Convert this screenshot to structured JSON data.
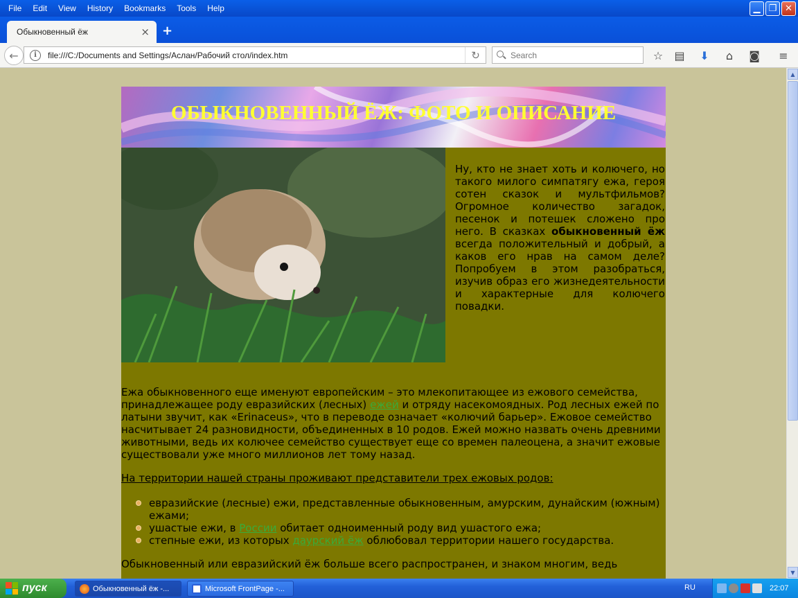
{
  "menu": [
    "File",
    "Edit",
    "View",
    "History",
    "Bookmarks",
    "Tools",
    "Help"
  ],
  "tab": {
    "title": "Обыкновенный ёж",
    "close": "×",
    "new": "+"
  },
  "nav": {
    "url": "file:///C:/Documents and Settings/Аслан/Рабочий стол/index.htm",
    "search_placeholder": "Search"
  },
  "page": {
    "title": "ОБЫКНОВЕННЫЙ ЁЖ: ФОТО И ОПИСАНИЕ",
    "intro_pre": "Ну, кто не знает хоть и колючего, но такого милого симпатягу ежа, героя сотен сказок и мультфильмов? Огромное количество загадок, песенок и потешек сложено про него. В сказках ",
    "intro_bold": "обыкновенный ёж",
    "intro_post": " всегда положительный и добрый, а каков его нрав на самом деле? Попробуем в этом разобраться, изучив образ его жизнедеятельности и характерные для колючего повадки.",
    "p1_a": "Ежа обыкновенного еще именуют европейским – это млекопитающее из ежового семейства, принадлежащее роду евразийских (лесных) ",
    "p1_link": "ежей",
    "p1_b": " и отряду насекомоядных. Род лесных ежей по латыни звучит, как «Erinaceus», что в переводе означает «колючий барьер». Ежовое семейство насчитывает 24 разновидности, объединенных в 10 родов. Ежей можно назвать очень древними животными, ведь их колючее семейство существует еще со времен палеоцена, а значит ежовые существовали уже много миллионов лет тому назад.",
    "subhead": "На территории нашей страны проживают представители трех ежовых родов:",
    "li1": "евразийские (лесные) ежи, представленные обыкновенным, амурским, дунайским (южным) ежами;",
    "li2_a": "ушастые ежи, в ",
    "li2_link": "России",
    "li2_b": " обитает одноименный роду вид ушастого ежа;",
    "li3_a": "степные ежи, из которых ",
    "li3_link": "даурский ёж",
    "li3_b": " облюбовал территории нашего государства.",
    "p2": "Обыкновенный или евразийский ёж больше всего распространен, и знаком многим, ведь"
  },
  "taskbar": {
    "start": "пуск",
    "tasks": [
      "Обыкновенный ёж -...",
      "Microsoft FrontPage -..."
    ],
    "lang": "RU",
    "clock": "22:07"
  },
  "colors": {
    "page_bg": "#7d7800",
    "title": "#ffff33",
    "link": "#3aab3a",
    "outer_bg": "#c9c49a"
  }
}
